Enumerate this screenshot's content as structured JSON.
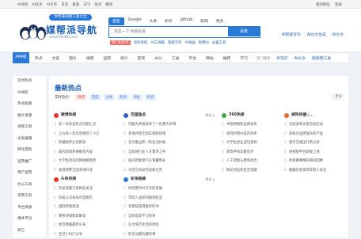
{
  "topbar": {
    "left": [
      "AI导航",
      "AI论文",
      "AI写作",
      "日历",
      "星座",
      "天气",
      "热点",
      "翻译"
    ],
    "right": [
      "我的网址",
      "登录"
    ]
  },
  "header": {
    "slogan": "你专属视频工具大全",
    "title": "媒帮派导航",
    "url": "www.MeiBP.com",
    "search_tabs": [
      "百度",
      "Google",
      "头条",
      "知乎",
      "github",
      "知网",
      "更多"
    ],
    "search_placeholder": "百度一下 你就知道",
    "search_button": "百度",
    "hot_links": [
      "热门AI写作",
      "创作导航",
      "AI工具箱",
      "智能写作",
      "AI绘画",
      "免费AI",
      "必备工具"
    ],
    "right_links": [
      "AI智能写作",
      "AI论文生成",
      "AI论文"
    ]
  },
  "nav": {
    "home": "AI导航",
    "items": [
      "热点",
      "文案",
      "图片",
      "视频",
      "运营",
      "统计",
      "变现",
      "办公",
      "工具",
      "平台",
      "网站",
      "推荐",
      "学习"
    ],
    "right": [
      "热门搜索",
      "AI写作",
      "AI论文",
      "短视频工具"
    ]
  },
  "sidebar": {
    "items": [
      "实时热点",
      "AI导航",
      "热点指南",
      "图片资源",
      "视频工具",
      "文案编辑",
      "转化变现",
      "运营推广",
      "用户运营",
      "办公工具",
      "常用工具",
      "平台资源",
      "媒体平台",
      "其它"
    ]
  },
  "main": {
    "title": "最新热点",
    "tag_label": "实时热点：",
    "tags": [
      "微博",
      "百度",
      "头条",
      "知乎",
      "B站",
      "抖音"
    ],
    "more": "更多",
    "cards": [
      {
        "title": "微博热搜",
        "color": "#e8342f",
        "more": "更多 ▸",
        "rows": [
          "前一日优选热点问题汇总",
          "上山进入北京后推荐了小方",
          "热播剧评分创新高",
          "国内新闻热搜推荐内容",
          "大学生热议的网络新趋势",
          "高温预警全国多地升温"
        ]
      },
      {
        "title": "百度热点",
        "color": "#2f5bd3",
        "more": "更多 ▸",
        "rows": [
          "可能为中国发布了一份重大声明",
          "多地开始全面实施新政策",
          "北京推出新一轮生活补贴",
          "互联网行业人才需求上升",
          "国内新能源汽车销量增长",
          "天宫空间站完成新任务"
        ]
      },
      {
        "title": "360热搜",
        "color": "#39a845",
        "more": "更多 ▸",
        "rows": [
          "中国网络新品牌发布",
          "如何利用AI提升效率",
          "大学生创业成功案例",
          "新款手机功能亮点",
          "人工智能与教育结合",
          "网友热议的生活话题"
        ]
      },
      {
        "title": "搜狗热搜",
        "color": "#e8632d",
        "more": "更多 ▸",
        "rows": [
          "全国多地文旅活动启动",
          "某知名品牌发布新产品",
          "城市交通出行新方式",
          "短视频平台新规上线",
          "体育赛事精彩瞬间回顾",
          "健康饮食受到年轻人关注"
        ]
      },
      {
        "title": "头条热搜",
        "color": "#e8342f",
        "more": "更多 ▸",
        "rows": [
          "热议话题引发网友关注",
          "科技公司发布年度报告",
          "国际新闻速递",
          "教育领域新政解读",
          "经济数据最新公布",
          "生活小窍门分享"
        ]
      },
      {
        "title": "知乎热榜",
        "color": "#2a79d6",
        "more": "更多 ▸",
        "rows": [
          "如何看待AI写作的发展",
          "年轻人该如何规划职业",
          "有哪些值得推荐的书",
          "怎样提高学习效率",
          "在大城市生活的体验",
          "你见过最有趣的事"
        ]
      }
    ]
  }
}
